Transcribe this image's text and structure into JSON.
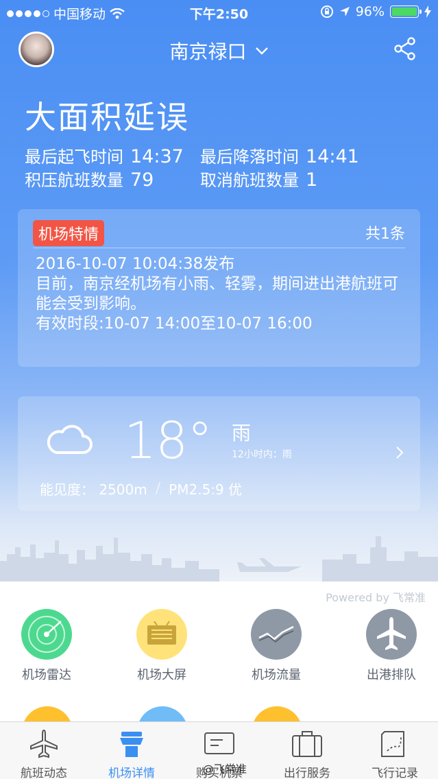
{
  "status_bar": {
    "carrier": "中国移动",
    "time": "下午2:50",
    "battery": "96%"
  },
  "header": {
    "airport_name": "南京禄口"
  },
  "summary": {
    "headline": "大面积延误",
    "last_takeoff_label": "最后起飞时间",
    "last_takeoff_value": "14:37",
    "last_landing_label": "最后降落时间",
    "last_landing_value": "14:41",
    "backlog_label": "积压航班数量",
    "backlog_value": "79",
    "cancelled_label": "取消航班数量",
    "cancelled_value": "1"
  },
  "notice": {
    "tag": "机场特情",
    "count": "共1条",
    "published": "2016-10-07 10:04:38发布",
    "content": "目前，南京经机场有小雨、轻雾，期间进出港航班可能会受到影响。",
    "valid_period": "有效时段:10-07 14:00至10-07 16:00"
  },
  "weather": {
    "icon": "cloud-icon",
    "temperature": "18°",
    "condition": "雨",
    "forecast": "12小时内：雨",
    "visibility": "能见度： 2500m",
    "air_quality": "PM2.5:9 优"
  },
  "powered_by": "Powered by 飞常准",
  "functions": [
    {
      "label": "机场雷达",
      "icon": "radar-icon",
      "color": "#4cd98f"
    },
    {
      "label": "机场大屏",
      "icon": "board-icon",
      "color": "#ffe27a"
    },
    {
      "label": "机场流量",
      "icon": "traffic-chart-icon",
      "color": "#8f99a6"
    },
    {
      "label": "出港排队",
      "icon": "plane-queue-icon",
      "color": "#8f99a6"
    }
  ],
  "tabs": [
    {
      "label": "航班动态",
      "icon": "plane-icon"
    },
    {
      "label": "机场详情",
      "icon": "control-tower-icon",
      "active": true
    },
    {
      "label": "购买机票",
      "icon": "ticket-icon"
    },
    {
      "label": "出行服务",
      "icon": "suitcase-icon"
    },
    {
      "label": "飞行记录",
      "icon": "route-map-icon"
    }
  ],
  "watermark": "@飞常准",
  "colors": {
    "accent": "#3a8ff0",
    "alert": "#f25545",
    "battery": "#4cd964"
  }
}
